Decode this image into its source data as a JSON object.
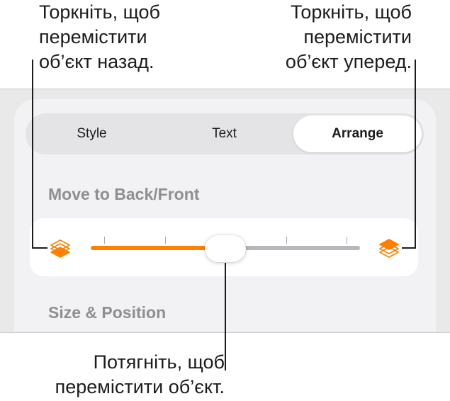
{
  "callouts": {
    "back": "Торкніть, щоб\nперемістити\nоб’єкт назад.",
    "front": "Торкніть, щоб\nперемістити\nоб’єкт уперед.",
    "drag": "Потягніть, щоб\nперемістити об’єкт."
  },
  "tabs": [
    {
      "label": "Style",
      "selected": false
    },
    {
      "label": "Text",
      "selected": false
    },
    {
      "label": "Arrange",
      "selected": true
    }
  ],
  "sections": {
    "move_title": "Move to Back/Front",
    "size_title": "Size & Position"
  },
  "slider": {
    "value_fraction": 0.5,
    "tick_count": 5,
    "accent_color": "#ff7f00",
    "back_icon": "layers-back-icon",
    "front_icon": "layers-front-icon"
  }
}
